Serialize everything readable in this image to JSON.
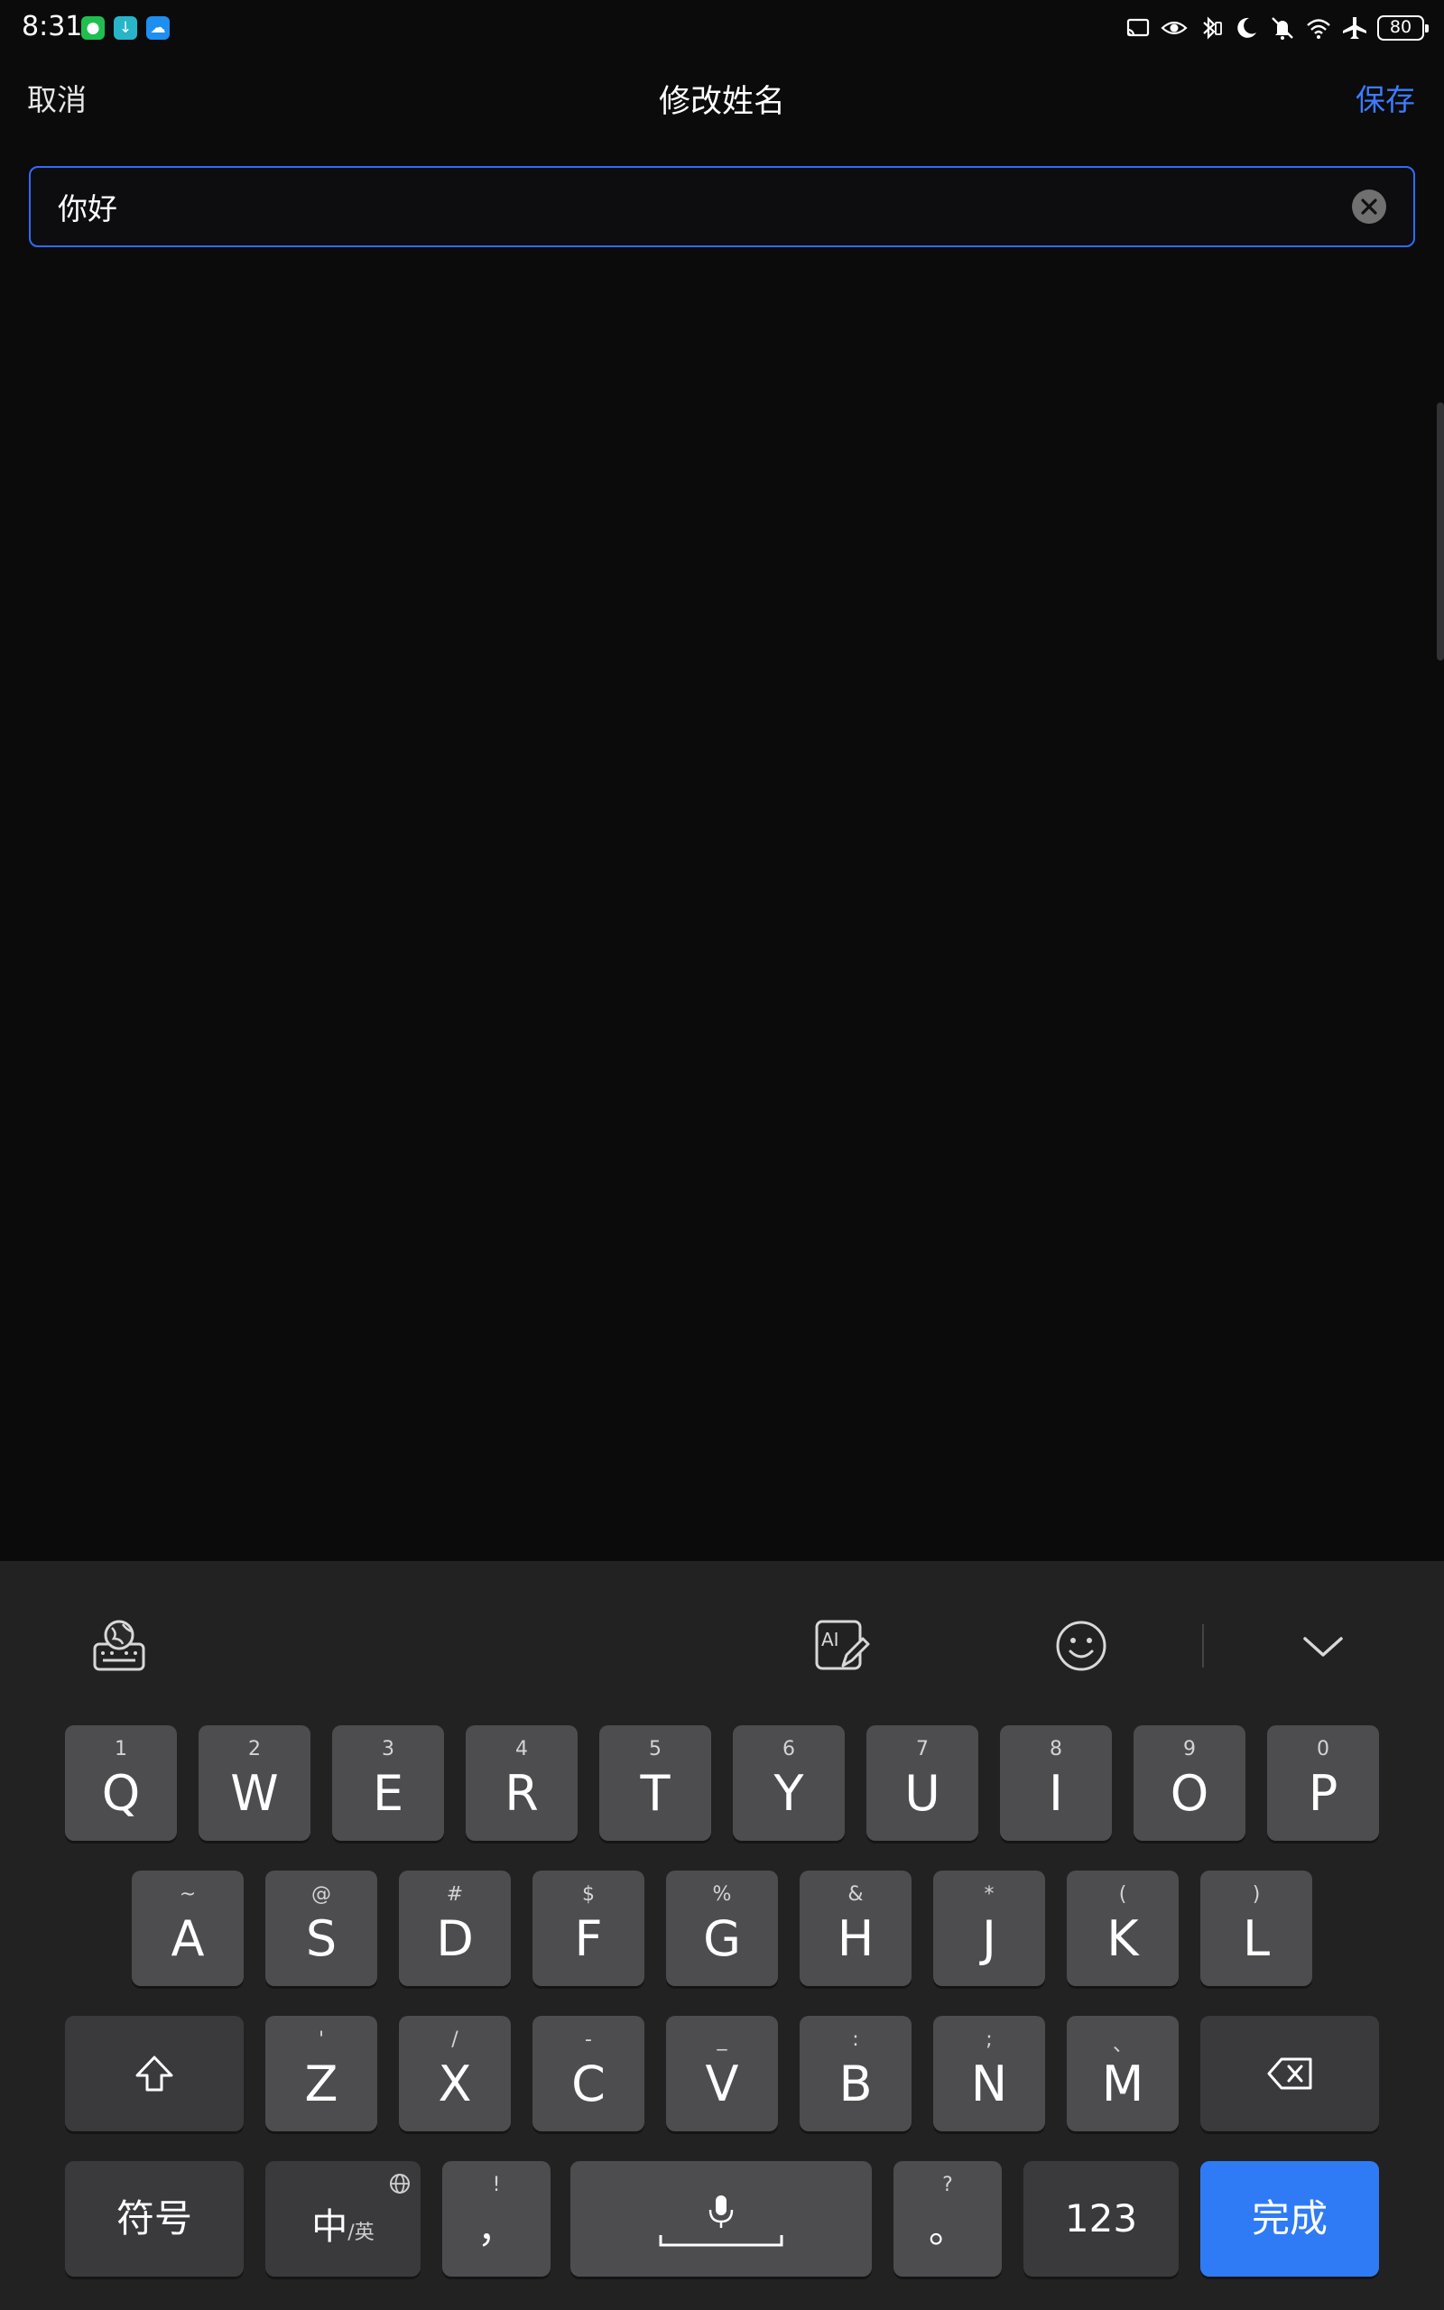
{
  "status_bar": {
    "time": "8:31",
    "battery": "80",
    "notification_icons": [
      "wechat-icon",
      "download-icon",
      "cloud-icon"
    ],
    "system_icons": [
      "cast-icon",
      "eye-icon",
      "bluetooth-icon",
      "moon-icon",
      "mute-icon",
      "wifi-icon",
      "airplane-icon"
    ]
  },
  "header": {
    "cancel": "取消",
    "title": "修改姓名",
    "save": "保存"
  },
  "name_input": {
    "value": "你好"
  },
  "colors": {
    "accent": "#3d7bff",
    "background": "#0b0b0c",
    "keyboard_bg": "#222222",
    "key": "#4d4d4f",
    "done_key": "#2f7bf5"
  },
  "keyboard": {
    "toolbar": [
      "keyboard-settings-icon",
      "ai-write-icon",
      "emoji-icon",
      "collapse-keyboard-icon"
    ],
    "row1": [
      {
        "hint": "1",
        "key": "Q"
      },
      {
        "hint": "2",
        "key": "W"
      },
      {
        "hint": "3",
        "key": "E"
      },
      {
        "hint": "4",
        "key": "R"
      },
      {
        "hint": "5",
        "key": "T"
      },
      {
        "hint": "6",
        "key": "Y"
      },
      {
        "hint": "7",
        "key": "U"
      },
      {
        "hint": "8",
        "key": "I"
      },
      {
        "hint": "9",
        "key": "O"
      },
      {
        "hint": "0",
        "key": "P"
      }
    ],
    "row2": [
      {
        "hint": "~",
        "key": "A"
      },
      {
        "hint": "@",
        "key": "S"
      },
      {
        "hint": "#",
        "key": "D"
      },
      {
        "hint": "$",
        "key": "F"
      },
      {
        "hint": "%",
        "key": "G"
      },
      {
        "hint": "&",
        "key": "H"
      },
      {
        "hint": "*",
        "key": "J"
      },
      {
        "hint": "(",
        "key": "K"
      },
      {
        "hint": ")",
        "key": "L"
      }
    ],
    "row3": [
      {
        "hint": "'",
        "key": "Z"
      },
      {
        "hint": "/",
        "key": "X"
      },
      {
        "hint": "-",
        "key": "C"
      },
      {
        "hint": "_",
        "key": "V"
      },
      {
        "hint": ":",
        "key": "B"
      },
      {
        "hint": ";",
        "key": "N"
      },
      {
        "hint": "、",
        "key": "M"
      }
    ],
    "bottom": {
      "symbols": "符号",
      "lang_main": "中",
      "lang_sub": "/英",
      "comma_hint": "!",
      "comma": "，",
      "period_hint": "?",
      "period": "。",
      "numbers": "123",
      "done": "完成"
    }
  }
}
